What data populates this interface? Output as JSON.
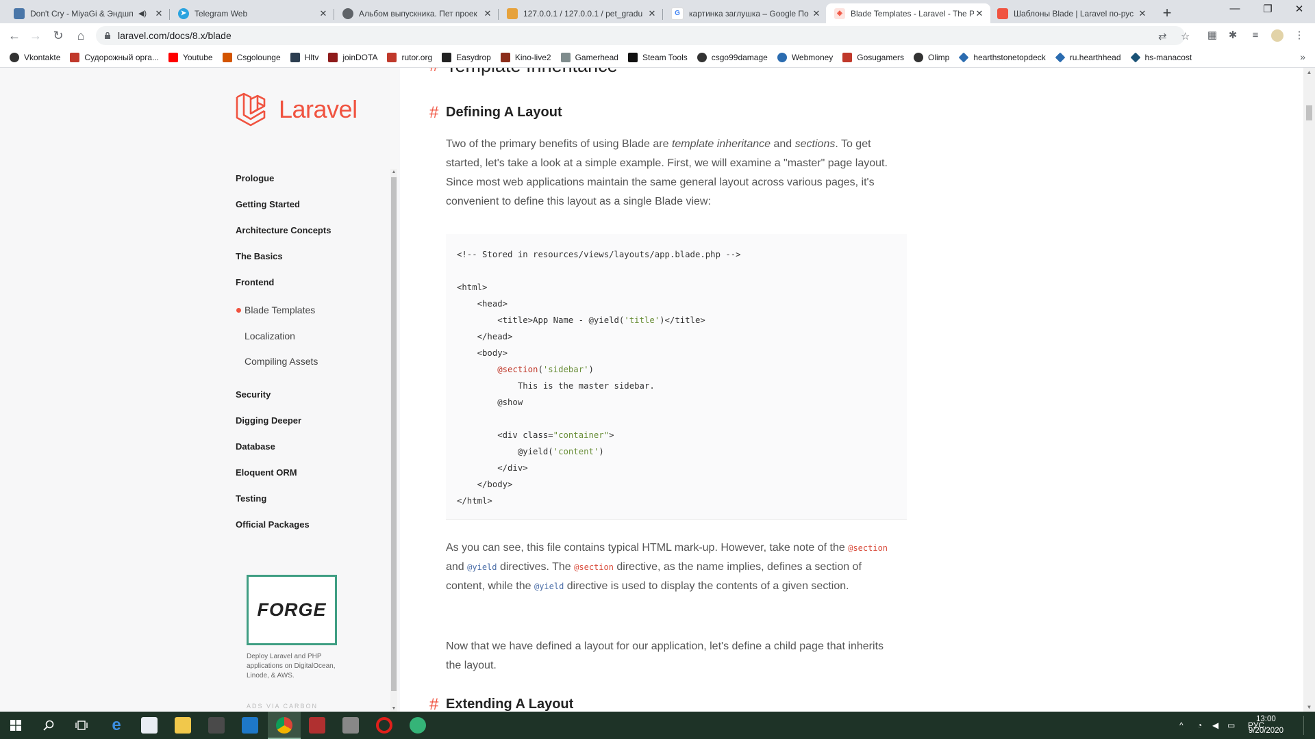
{
  "browser": {
    "tabs": [
      {
        "title": "Don't Cry - MiyaGi & Эндшп",
        "favicon_color": "#4a76a8",
        "active": false
      },
      {
        "title": "Telegram Web",
        "favicon_color": "#2aa3df",
        "active": false
      },
      {
        "title": "Альбом выпускника. Пет проек",
        "favicon_color": "#5f6368",
        "active": false
      },
      {
        "title": "127.0.0.1 / 127.0.0.1 / pet_gradu",
        "favicon_color": "#e6a23c",
        "active": false
      },
      {
        "title": "картинка заглушка – Google По",
        "favicon_color": "#4285f4",
        "active": false
      },
      {
        "title": "Blade Templates - Laravel - The P",
        "favicon_color": "#f05340",
        "active": true
      },
      {
        "title": "Шаблоны Blade | Laravel по-рус",
        "favicon_color": "#f05340",
        "active": false
      }
    ],
    "new_tab": "+",
    "window_controls": {
      "minimize": "—",
      "maximize": "❐",
      "close": "✕"
    },
    "url": "laravel.com/docs/8.x/blade",
    "nav": {
      "back": "←",
      "forward": "→",
      "reload": "↻",
      "home": "⌂"
    },
    "bookmarks": [
      {
        "label": "Vkontakte",
        "color": "#333"
      },
      {
        "label": "Судорожный орга...",
        "color": "#c0392b"
      },
      {
        "label": "Youtube",
        "color": "#ff0000"
      },
      {
        "label": "Csgolounge",
        "color": "#d35400"
      },
      {
        "label": "Hltv",
        "color": "#2c3e50"
      },
      {
        "label": "joinDOTA",
        "color": "#8e1b1b"
      },
      {
        "label": "rutor.org",
        "color": "#c0392b"
      },
      {
        "label": "Easydrop",
        "color": "#222"
      },
      {
        "label": "Kino-live2",
        "color": "#8b2d1a"
      },
      {
        "label": "Gamerhead",
        "color": "#7f8c8d"
      },
      {
        "label": "Steam Tools",
        "color": "#111"
      },
      {
        "label": "csgo99damage",
        "color": "#333"
      },
      {
        "label": "Webmoney",
        "color": "#2b6cb0"
      },
      {
        "label": "Gosugamers",
        "color": "#c0392b"
      },
      {
        "label": "Olimp",
        "color": "#333"
      },
      {
        "label": "hearthstonetopdeck",
        "color": "#2b6cb0"
      },
      {
        "label": "ru.hearthhead",
        "color": "#2b6cb0"
      },
      {
        "label": "hs-manacost",
        "color": "#1a5276"
      }
    ],
    "bookmarks_more": "»"
  },
  "sidebar": {
    "logo_text": "Laravel",
    "sections": [
      {
        "label": "Prologue"
      },
      {
        "label": "Getting Started"
      },
      {
        "label": "Architecture Concepts"
      },
      {
        "label": "The Basics"
      },
      {
        "label": "Frontend"
      }
    ],
    "frontend_items": [
      {
        "label": "Blade Templates",
        "current": true
      },
      {
        "label": "Localization",
        "current": false
      },
      {
        "label": "Compiling Assets",
        "current": false
      }
    ],
    "sections_after": [
      {
        "label": "Security"
      },
      {
        "label": "Digging Deeper"
      },
      {
        "label": "Database"
      },
      {
        "label": "Eloquent ORM"
      },
      {
        "label": "Testing"
      },
      {
        "label": "Official Packages"
      }
    ],
    "ad": {
      "logo_text": "FORGE",
      "text": "Deploy Laravel and PHP applications on DigitalOcean, Linode, & AWS.",
      "tag": "ADS VIA CARBON"
    }
  },
  "content": {
    "hash": "#",
    "heading_top": "Template Inheritance",
    "heading_defining": "Defining A Layout",
    "para1": {
      "a": "Two of the primary benefits of using Blade are ",
      "b": "template inheritance",
      "c": " and ",
      "d": "sections",
      "e": ". To get started, let's take a look at a simple example. First, we will examine a \"master\" page layout. Since most web applications maintain the same general layout across various pages, it's convenient to define this layout as a single Blade view:"
    },
    "code_lines": [
      "<!-- Stored in resources/views/layouts/app.blade.php -->",
      "",
      "<html>",
      "    <head>",
      "        <title>App Name - @yield('title')</title>",
      "    </head>",
      "    <body>",
      "        @section('sidebar')",
      "            This is the master sidebar.",
      "        @show",
      "",
      "        <div class=\"container\">",
      "            @yield('content')",
      "        </div>",
      "    </body>",
      "</html>"
    ],
    "para2": {
      "a": "As you can see, this file contains typical HTML mark-up. However, take note of the ",
      "code1": "@section",
      "b": " and ",
      "code2": "@yield",
      "c": " directives. The ",
      "code3": "@section",
      "d": " directive, as the name implies, defines a section of content, while the ",
      "code4": "@yield",
      "e": " directive is used to display the contents of a given section."
    },
    "para3": "Now that we have defined a layout for our application, let's define a child page that inherits the layout.",
    "heading_extending": "Extending A Layout"
  },
  "taskbar": {
    "language": "РУС",
    "time": "13:00",
    "date": "9/20/2020",
    "tray_chevron": "^"
  }
}
